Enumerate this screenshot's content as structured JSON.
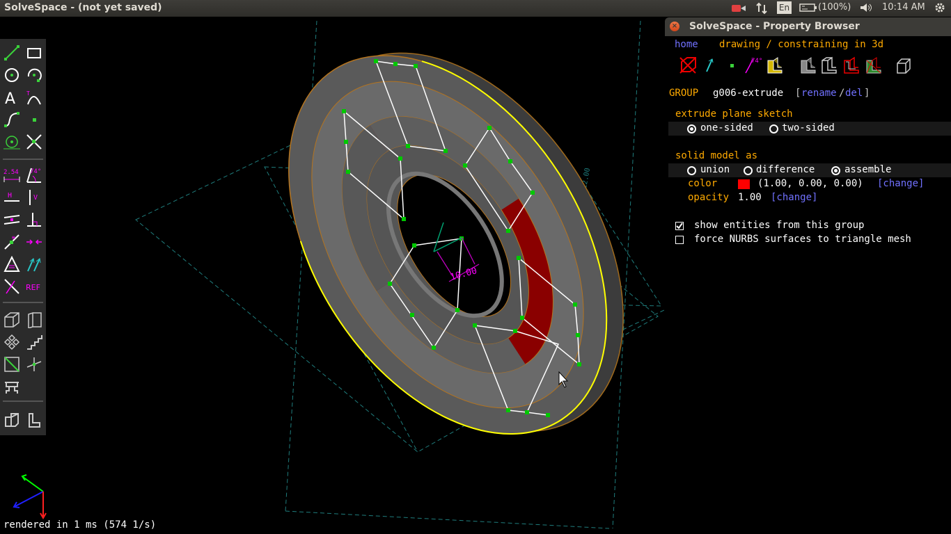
{
  "window": {
    "title": "SolveSpace - (not yet saved)"
  },
  "tray": {
    "lang": "En",
    "battery": "(100%)",
    "clock": "10:14 AM"
  },
  "viewport": {
    "dimension_label": "10.00",
    "status": "rendered in 1 ms (574 1/s)"
  },
  "toolbar": {
    "dim_label": "2.54",
    "angle_label": "74°",
    "h_label": "H",
    "v_label": "V",
    "ref_label": "REF"
  },
  "property_browser": {
    "title": "SolveSpace - Property Browser",
    "nav_home": "home",
    "nav_hint": "drawing / constraining in 3d",
    "icon_angle_label": "74°",
    "group_label": "GROUP",
    "group_name": "g006-extrude",
    "rename": "rename",
    "del": "del",
    "extrude_heading": "extrude plane sketch",
    "one_sided": "one-sided",
    "two_sided": "two-sided",
    "solid_heading": "solid model as",
    "union": "union",
    "difference": "difference",
    "assemble": "assemble",
    "color_label": "color",
    "color_value": "(1.00, 0.00, 0.00)",
    "color_swatch": "#ff0000",
    "change": "[change]",
    "opacity_label": "opacity",
    "opacity_value": "1.00",
    "show_entities": "show entities from this group",
    "force_nurbs": "force NURBS surfaces to triangle mesh"
  },
  "colors": {
    "accent_link": "#7171ff",
    "heading": "#ffaa00",
    "point": "#00c800",
    "highlight": "#ffff00"
  }
}
